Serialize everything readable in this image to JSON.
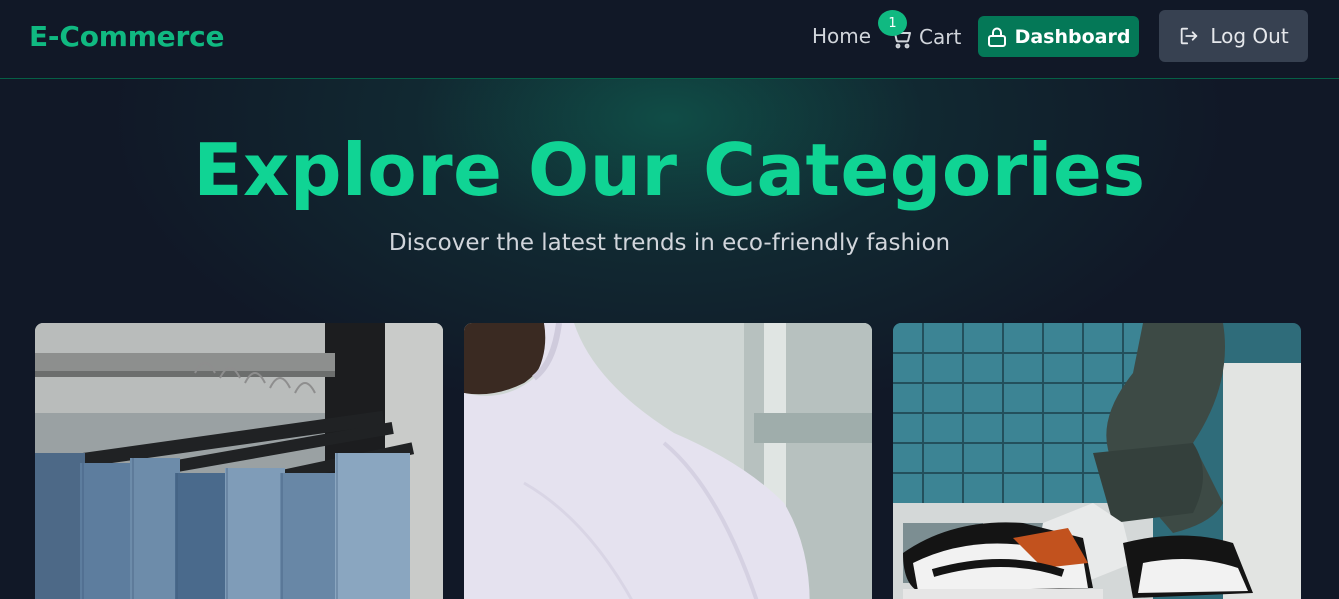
{
  "header": {
    "brand": "E-Commerce",
    "nav": {
      "home": "Home",
      "cart": "Cart",
      "cart_count": "1"
    },
    "dashboard_label": "Dashboard",
    "logout_label": "Log Out"
  },
  "hero": {
    "title": "Explore Our Categories",
    "subtitle": "Discover the latest trends in eco-friendly fashion"
  },
  "categories": [
    {
      "image": "jeans-on-hangers-photo"
    },
    {
      "image": "white-tshirt-photo"
    },
    {
      "image": "sneakers-photo"
    }
  ],
  "colors": {
    "accent": "#10b981",
    "accent_dark": "#047857",
    "background": "#111827",
    "logout_button": "#374151"
  },
  "icons": [
    "cart-icon",
    "lock-icon",
    "logout-icon"
  ]
}
